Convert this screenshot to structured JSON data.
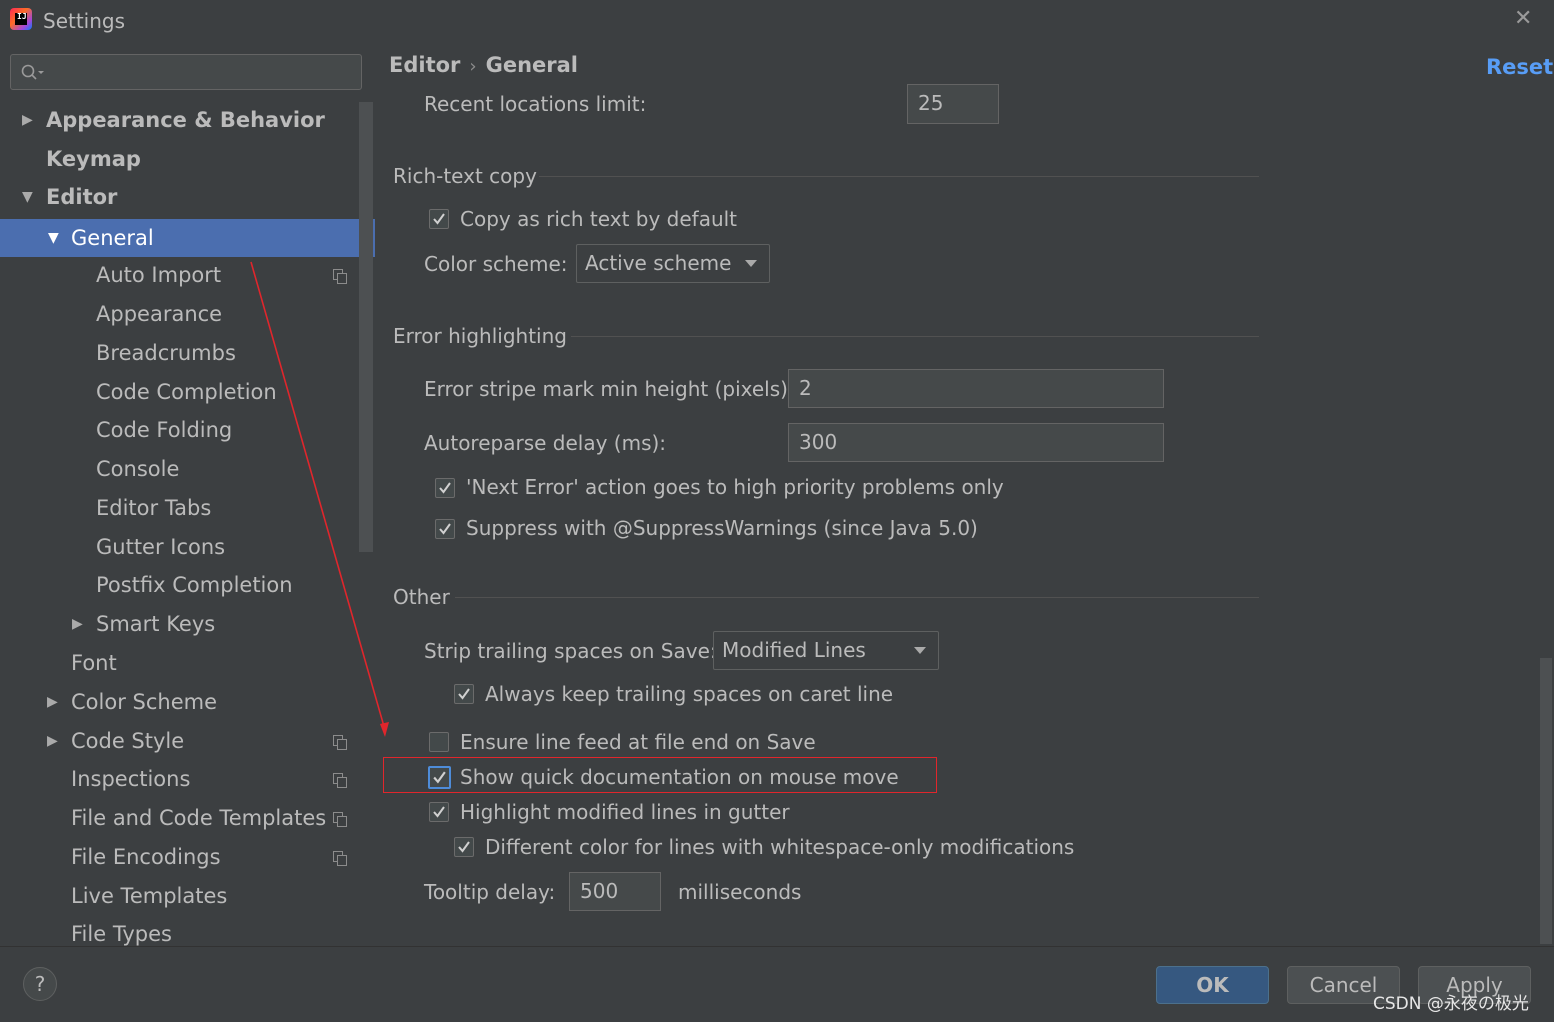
{
  "window": {
    "title": "Settings"
  },
  "sidebar": {
    "search_placeholder": "",
    "items": [
      {
        "label": "Appearance & Behavior",
        "arrow": "▶"
      },
      {
        "label": "Keymap",
        "arrow": ""
      },
      {
        "label": "Editor",
        "arrow": "▼"
      },
      {
        "label": "General",
        "arrow": "▼"
      },
      {
        "label": "Auto Import"
      },
      {
        "label": "Appearance"
      },
      {
        "label": "Breadcrumbs"
      },
      {
        "label": "Code Completion"
      },
      {
        "label": "Code Folding"
      },
      {
        "label": "Console"
      },
      {
        "label": "Editor Tabs"
      },
      {
        "label": "Gutter Icons"
      },
      {
        "label": "Postfix Completion"
      },
      {
        "label": "Smart Keys",
        "arrow": "▶"
      },
      {
        "label": "Font"
      },
      {
        "label": "Color Scheme",
        "arrow": "▶"
      },
      {
        "label": "Code Style",
        "arrow": "▶"
      },
      {
        "label": "Inspections"
      },
      {
        "label": "File and Code Templates"
      },
      {
        "label": "File Encodings"
      },
      {
        "label": "Live Templates"
      },
      {
        "label": "File Types"
      }
    ]
  },
  "header": {
    "crumb1": "Editor",
    "separator": "›",
    "crumb2": "General",
    "reset": "Reset"
  },
  "content": {
    "recent_locations_label": "Recent locations limit:",
    "recent_locations_value": "25",
    "rich_text": {
      "title": "Rich-text copy",
      "copy_rich_label": "Copy as rich text by default",
      "copy_rich_checked": true,
      "color_scheme_label": "Color scheme:",
      "color_scheme_value": "Active scheme"
    },
    "error": {
      "title": "Error highlighting",
      "stripe_label": "Error stripe mark min height (pixels):",
      "stripe_value": "2",
      "autoreparse_label": "Autoreparse delay (ms):",
      "autoreparse_value": "300",
      "next_error_label": "'Next Error' action goes to high priority problems only",
      "next_error_checked": true,
      "suppress_label": "Suppress with @SuppressWarnings (since Java 5.0)",
      "suppress_checked": true
    },
    "other": {
      "title": "Other",
      "strip_label": "Strip trailing spaces on Save:",
      "strip_value": "Modified Lines",
      "keep_trailing_label": "Always keep trailing spaces on caret line",
      "keep_trailing_checked": true,
      "line_feed_label": "Ensure line feed at file end on Save",
      "line_feed_checked": false,
      "quick_doc_label": "Show quick documentation on mouse move",
      "quick_doc_checked": true,
      "highlight_modified_label": "Highlight modified lines in gutter",
      "highlight_modified_checked": true,
      "diff_color_label": "Different color for lines with whitespace-only modifications",
      "diff_color_checked": true,
      "tooltip_label": "Tooltip delay:",
      "tooltip_value": "500",
      "tooltip_unit": "milliseconds"
    }
  },
  "footer": {
    "help": "?",
    "ok": "OK",
    "cancel": "Cancel",
    "apply": "Apply",
    "watermark": "CSDN @永夜の极光"
  },
  "colors": {
    "background": "#3c3f41",
    "selection": "#4b6eaf",
    "link": "#589df6",
    "annotation": "#e0262c"
  }
}
